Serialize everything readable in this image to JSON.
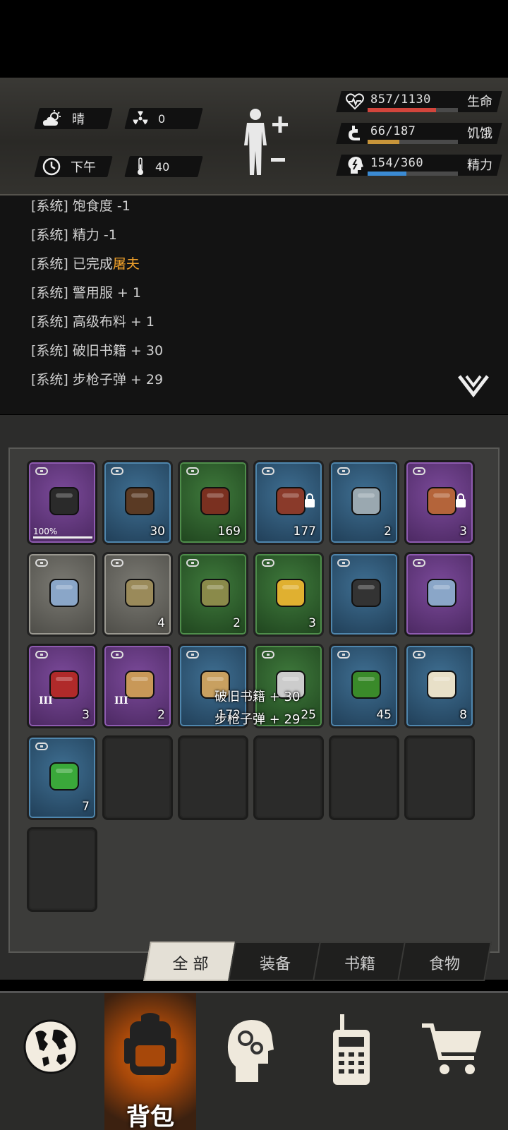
{
  "status": {
    "weather": {
      "label": "晴",
      "icon": "cloud-sun-icon"
    },
    "radiation": {
      "value": "0",
      "icon": "radiation-icon"
    },
    "time": {
      "label": "下午",
      "icon": "clock-icon"
    },
    "temperature": {
      "value": "40",
      "icon": "thermometer-icon"
    },
    "body_icon": "body-figure-icon",
    "stats": [
      {
        "name": "生命",
        "value": "857/1130",
        "fraction": 0.758,
        "color": "#d2453c",
        "icon": "heart-pulse-icon"
      },
      {
        "name": "饥饿",
        "value": "66/187",
        "fraction": 0.353,
        "color": "#c8953a",
        "icon": "stomach-icon"
      },
      {
        "name": "精力",
        "value": "154/360",
        "fraction": 0.428,
        "color": "#3b8bd4",
        "icon": "head-energy-icon"
      }
    ]
  },
  "log": {
    "lines": [
      {
        "prefix": "[系统]",
        "text": "饱食度 -1",
        "highlight": ""
      },
      {
        "prefix": "[系统]",
        "text": "精力 -1",
        "highlight": ""
      },
      {
        "prefix": "[系统]",
        "text": "已完成",
        "highlight": "屠夫"
      },
      {
        "prefix": "[系统]",
        "text": "警用服 + 1",
        "highlight": ""
      },
      {
        "prefix": "[系统]",
        "text": "高级布料 + 1",
        "highlight": ""
      },
      {
        "prefix": "[系统]",
        "text": "破旧书籍 + 30",
        "highlight": ""
      },
      {
        "prefix": "[系统]",
        "text": "步枪子弹 + 29",
        "highlight": ""
      }
    ],
    "expand_icon": "double-chevron-down-icon"
  },
  "inventory": {
    "items": [
      {
        "rarity": "purple",
        "icon": "jacket-icon",
        "count": "",
        "durability": "100%",
        "locked": false,
        "tier": ""
      },
      {
        "rarity": "blue",
        "icon": "book-icon",
        "count": "30",
        "locked": false,
        "tier": ""
      },
      {
        "rarity": "green",
        "icon": "raw-meat-strips-icon",
        "count": "169",
        "locked": false,
        "tier": ""
      },
      {
        "rarity": "blue",
        "icon": "steak-skewer-icon",
        "count": "177",
        "locked": true,
        "tier": ""
      },
      {
        "rarity": "blue",
        "icon": "bento-box-icon",
        "count": "2",
        "locked": false,
        "tier": ""
      },
      {
        "rarity": "purple",
        "icon": "fish-dish-icon",
        "count": "3",
        "locked": true,
        "tier": ""
      },
      {
        "rarity": "grey",
        "icon": "cloth-icon",
        "count": "",
        "locked": false,
        "tier": ""
      },
      {
        "rarity": "grey",
        "icon": "scrap-metal-icon",
        "count": "4",
        "locked": false,
        "tier": ""
      },
      {
        "rarity": "green",
        "icon": "scrap-parts-icon",
        "count": "2",
        "locked": false,
        "tier": ""
      },
      {
        "rarity": "green",
        "icon": "cheese-icon",
        "count": "3",
        "locked": false,
        "tier": ""
      },
      {
        "rarity": "blue",
        "icon": "metal-ingot-icon",
        "count": "",
        "locked": false,
        "tier": ""
      },
      {
        "rarity": "purple",
        "icon": "cloth-icon",
        "count": "",
        "locked": false,
        "tier": ""
      },
      {
        "rarity": "purple",
        "icon": "syringe-red-icon",
        "count": "3",
        "locked": false,
        "tier": "III"
      },
      {
        "rarity": "purple",
        "icon": "bullets-icon",
        "count": "2",
        "locked": false,
        "tier": "III"
      },
      {
        "rarity": "blue",
        "icon": "ammo-box-icon",
        "count": "172",
        "locked": false,
        "tier": ""
      },
      {
        "rarity": "green",
        "icon": "medicine-can-icon",
        "count": "25",
        "locked": false,
        "tier": ""
      },
      {
        "rarity": "blue",
        "icon": "herb-mat-icon",
        "count": "45",
        "locked": false,
        "tier": ""
      },
      {
        "rarity": "blue",
        "icon": "spray-medkit-icon",
        "count": "8",
        "locked": false,
        "tier": ""
      },
      {
        "rarity": "blue",
        "icon": "syringe-green-icon",
        "count": "7",
        "locked": false,
        "tier": ""
      }
    ],
    "empty_slots": 6
  },
  "toast": {
    "lines": [
      "破旧书籍 + 30",
      "步枪子弹 + 29"
    ]
  },
  "tabs": [
    {
      "label": "全 部",
      "active": true
    },
    {
      "label": "装备",
      "active": false
    },
    {
      "label": "书籍",
      "active": false
    },
    {
      "label": "食物",
      "active": false
    }
  ],
  "nav": [
    {
      "icon": "globe-icon",
      "label": "",
      "active": false
    },
    {
      "icon": "backpack-icon",
      "label": "背包",
      "active": true
    },
    {
      "icon": "brain-head-icon",
      "label": "",
      "active": false
    },
    {
      "icon": "walkie-talkie-icon",
      "label": "",
      "active": false
    },
    {
      "icon": "shopping-cart-icon",
      "label": "",
      "active": false
    }
  ]
}
